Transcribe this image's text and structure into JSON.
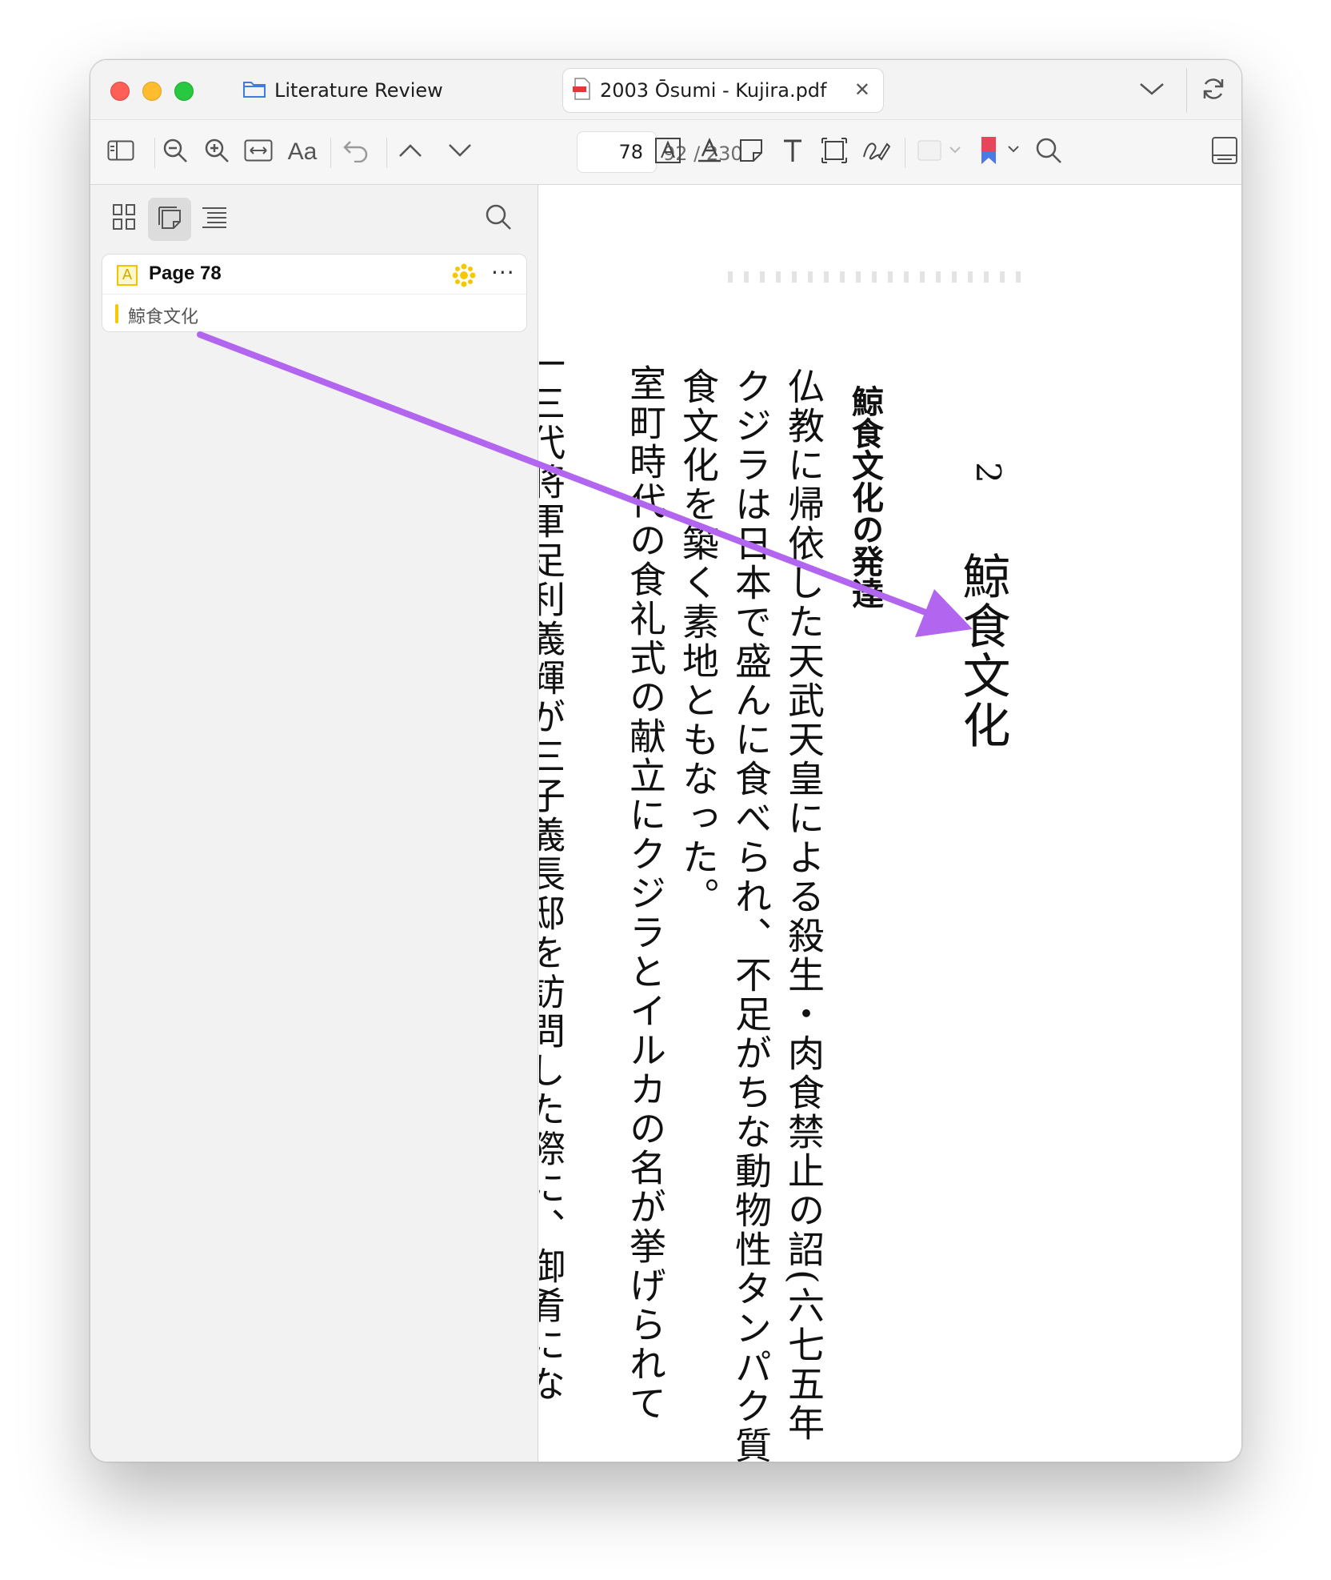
{
  "window": {
    "folder_tab_label": "Literature Review",
    "document_tab_label": "2003 Ōsumi - Kujira.pdf",
    "close_glyph": "✕"
  },
  "toolbar": {
    "font_button_label": "Aa",
    "current_page": "78",
    "total_pages": "92 / 230"
  },
  "sidebar": {
    "annotation": {
      "page_label": "Page 78",
      "badge_glyph": "A",
      "more_glyph": "···",
      "highlight_text": "鯨食文化",
      "highlight_color": "#f5c800"
    }
  },
  "document": {
    "chapter_number": "2",
    "chapter_title": "鯨食文化",
    "section_heading": "鯨食文化の発達",
    "body_columns": [
      "仏教に帰依した天武天皇による殺生・肉食禁止の詔(六七五年",
      "クジラは日本で盛んに食べられ、不足がちな動物性タンパク質を",
      "食文化を築く素地ともなった。",
      "室町時代の食礼式の献立にクジラとイルカの名が挙げられて",
      "一三代将軍足利義輝が三子義長邸を訪問した際に、御肴にな"
    ]
  },
  "colors": {
    "arrow": "#b265ee",
    "accent_blue": "#2f6fe0",
    "bookmark_red": "#e8445a"
  },
  "icons": [
    "sidebar-toggle-icon",
    "zoom-out-icon",
    "zoom-in-icon",
    "fit-width-icon",
    "undo-icon",
    "chevron-up-icon",
    "chevron-down-icon",
    "text-highlight-icon",
    "note-icon",
    "text-box-icon",
    "rect-select-icon",
    "signature-icon",
    "color-swatch-icon",
    "bookmark-icon",
    "search-icon",
    "panel-icon",
    "thumbnails-icon",
    "annotations-icon",
    "outline-icon",
    "folder-icon",
    "pdf-file-icon",
    "refresh-icon"
  ]
}
